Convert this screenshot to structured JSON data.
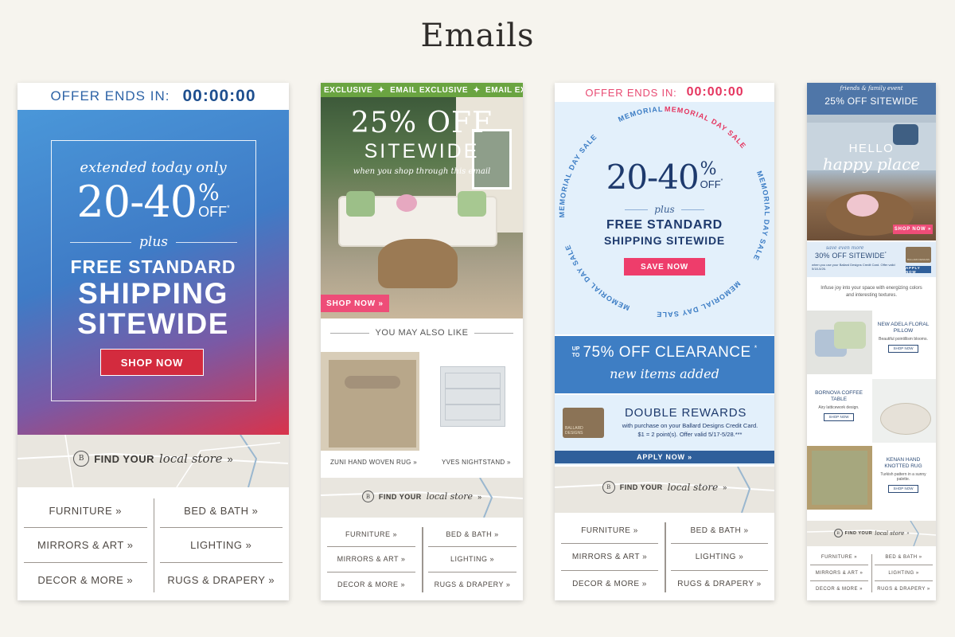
{
  "page": {
    "title": "Emails"
  },
  "email1": {
    "offer_label": "OFFER ENDS IN:",
    "countdown": "00:00:00",
    "tagline": "extended today only",
    "percent": "20-40",
    "percent_sign": "%",
    "off": "OFF",
    "asterisk": "*",
    "plus": "plus",
    "free_standard": "FREE STANDARD",
    "shipping": "SHIPPING",
    "sitewide": "SITEWIDE",
    "cta": "SHOP NOW",
    "store_find": "FIND YOUR",
    "store_local": "local store",
    "store_arrow": "»",
    "nav": [
      "FURNITURE »",
      "BED & BATH »",
      "MIRRORS & ART »",
      "LIGHTING »",
      "DECOR & MORE »",
      "RUGS & DRAPERY »"
    ]
  },
  "email2": {
    "ribbon": "EXCLUSIVE  ✦  EMAIL EXCLUSIVE  ✦  EMAIL EXCLUSIVE",
    "headline1": "25% OFF",
    "headline2": "SITEWIDE",
    "subline": "when you shop through this email",
    "cta": "SHOP NOW »",
    "section_title": "YOU MAY ALSO LIKE",
    "products": [
      "ZUNI HAND WOVEN RUG »",
      "YVES NIGHTSTAND »"
    ],
    "store_find": "FIND YOUR",
    "store_local": "local store",
    "store_arrow": "»",
    "nav": [
      "FURNITURE »",
      "BED & BATH »",
      "MIRRORS & ART »",
      "LIGHTING »",
      "DECOR & MORE »",
      "RUGS & DRAPERY »"
    ]
  },
  "email3": {
    "offer_label": "OFFER ENDS IN:",
    "countdown": "00:00:00",
    "ring_text": "MEMORIAL DAY SALE",
    "percent": "20-40",
    "percent_sign": "%",
    "off": "OFF",
    "asterisk": "*",
    "plus": "plus",
    "free_standard": "FREE STANDARD",
    "shipping_sitewide": "SHIPPING SITEWIDE",
    "cta": "SAVE NOW",
    "clearance_up": "UP",
    "clearance_to": "TO",
    "clearance_main": "75% OFF CLEARANCE",
    "clearance_asterisk": "*",
    "clearance_sub": "new items added",
    "rewards_title": "DOUBLE REWARDS",
    "rewards_line1": "with purchase on your Ballard Designs Credit Card.",
    "rewards_line2": "$1 = 2 point(s). Offer valid 5/17-5/28.***",
    "rewards_card_text": "BALLARD DESIGNS",
    "apply_cta": "APPLY NOW »",
    "store_find": "FIND YOUR",
    "store_local": "local store",
    "store_arrow": "»",
    "nav": [
      "FURNITURE »",
      "BED & BATH »",
      "MIRRORS & ART »",
      "LIGHTING »",
      "DECOR & MORE »",
      "RUGS & DRAPERY »"
    ]
  },
  "email4": {
    "event": "friends & family event",
    "headline": "25% OFF SITEWIDE",
    "hello": "HELLO",
    "happy_place": "happy place",
    "cta": "SHOP NOW »",
    "save_even_more": "save even more",
    "thirty_off": "30% OFF SITEWIDE",
    "thirty_asterisk": "*",
    "thirty_fine": "when you use your Ballard Designs Credit Card. Offer valid 5/18-5/26.",
    "card_text": "BALLARD DESIGNS",
    "apply": "APPLY NOW",
    "intro": "Infuse joy into your space with energizing colors and interesting textures.",
    "products": [
      {
        "title": "NEW ADELA FLORAL PILLOW",
        "desc": "Beautiful pointillism blooms.",
        "cta": "SHOP NOW"
      },
      {
        "title": "BORNOVA COFFEE TABLE",
        "desc": "Airy latticework design.",
        "cta": "SHOP NOW"
      },
      {
        "title": "KENAN HAND KNOTTED RUG",
        "desc": "Turkish pattern in a sunny palette.",
        "cta": "SHOP NOW"
      }
    ],
    "store_find": "FIND YOUR",
    "store_local": "local store",
    "store_arrow": "»",
    "nav": [
      "FURNITURE »",
      "BED & BATH »",
      "MIRRORS & ART »",
      "LIGHTING »",
      "DECOR & MORE »",
      "RUGS & DRAPERY »"
    ]
  },
  "colors": {
    "background": "#f6f4ee",
    "navy": "#1e3a6d",
    "blue": "#3f7fc1",
    "red": "#d62b44",
    "pink": "#ee3d6b",
    "light_blue": "#e2f0fb",
    "clearance_blue": "#3e7ec4",
    "slate_blue": "#4f76a8"
  },
  "icons": [
    "store-logo-icon",
    "map-pin-icon"
  ]
}
